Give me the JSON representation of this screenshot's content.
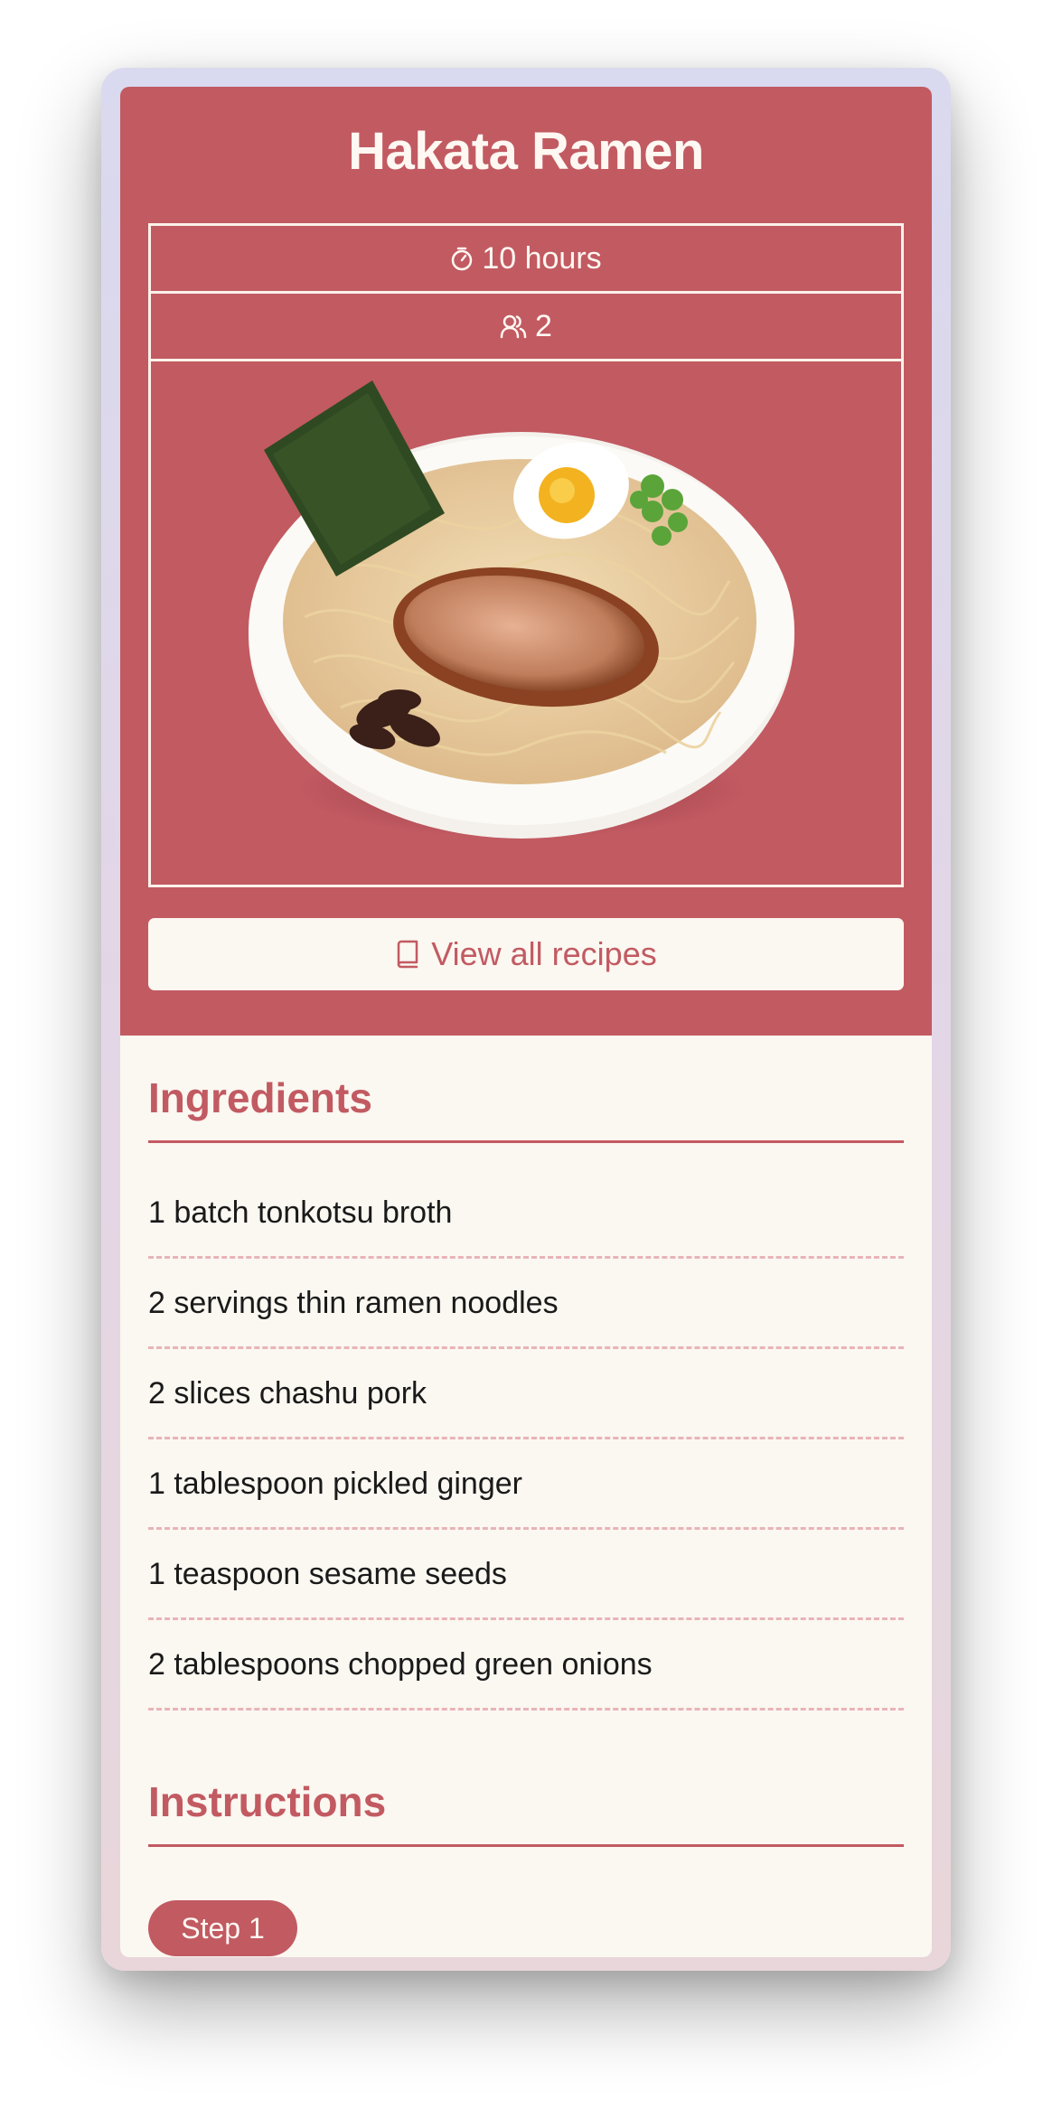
{
  "recipe": {
    "title": "Hakata Ramen",
    "time": "10 hours",
    "servings": "2",
    "view_all_label": "View all recipes"
  },
  "ingredients": {
    "heading": "Ingredients",
    "items": [
      "1 batch tonkotsu broth",
      "2 servings thin ramen noodles",
      "2 slices chashu pork",
      "1 tablespoon pickled ginger",
      "1 teaspoon sesame seeds",
      "2 tablespoons chopped green onions"
    ]
  },
  "instructions": {
    "heading": "Instructions",
    "step_label": "Step 1"
  },
  "icons": {
    "time": "stopwatch-icon",
    "servings": "users-icon",
    "view_all": "book-icon"
  },
  "colors": {
    "accent": "#c25a62",
    "background": "#fbf7f1",
    "dashed_divider": "#e8b4b8"
  }
}
